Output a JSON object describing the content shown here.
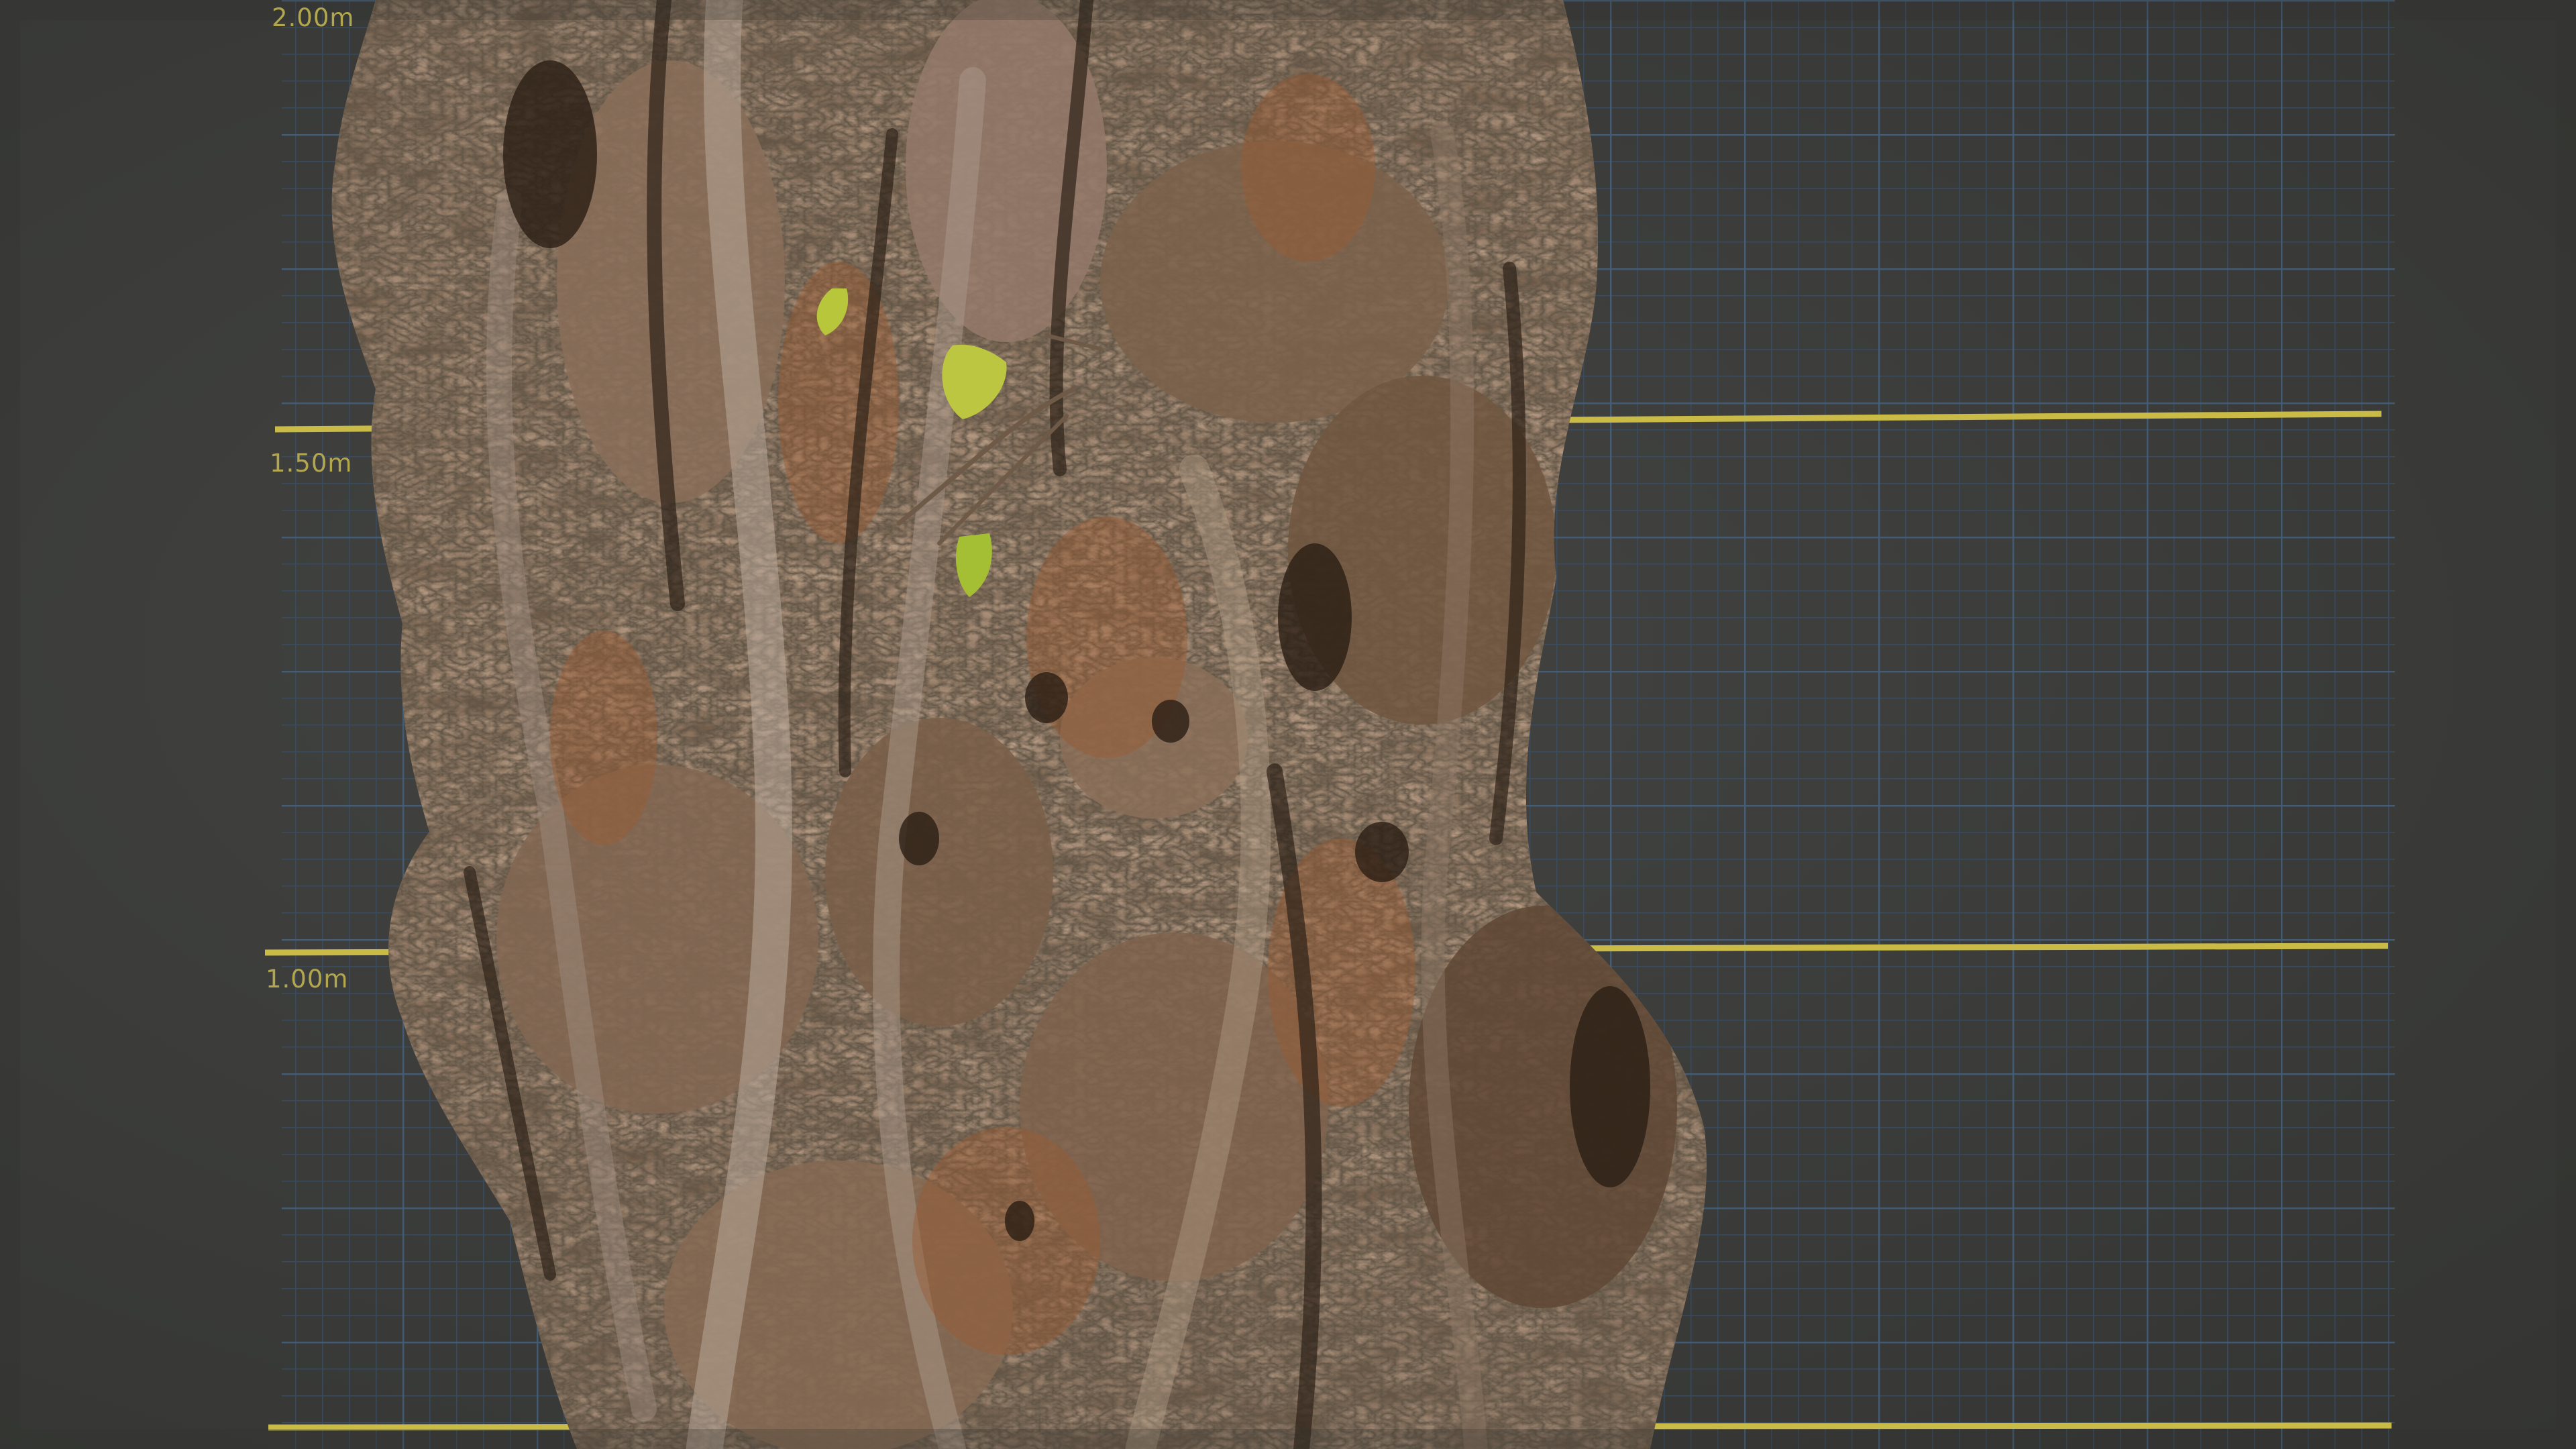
{
  "scene": {
    "subject": "tree-trunk",
    "backdrop": "measurement-grid-board"
  },
  "scale_labels": {
    "mark_2_00": "2.00m",
    "mark_1_50": "1.50m",
    "mark_1_00": "1.00m"
  },
  "colors": {
    "backdrop": "#3c3d3b",
    "grid_minor": "#3a4f66",
    "grid_major": "#4f6e8c",
    "scale_line": "#c9bb45",
    "label": "#b2a74f",
    "bark_dark": "#4a3826",
    "bark_mid": "#7d6048",
    "bark_light": "#a89584",
    "bark_rust": "#9a5a34",
    "leaf": "#b4c23a"
  }
}
